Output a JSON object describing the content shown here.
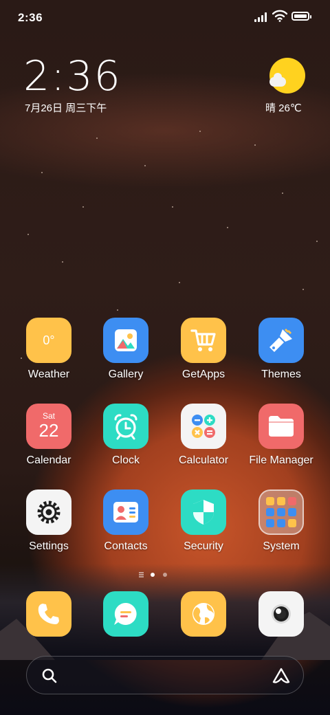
{
  "status_bar": {
    "time": "2:36"
  },
  "clock_widget": {
    "time": "2:36",
    "date": "7月26日 周三下午"
  },
  "weather_widget": {
    "text": "晴 26℃"
  },
  "apps": {
    "weather": {
      "label": "Weather",
      "icon_text": "0°"
    },
    "gallery": {
      "label": "Gallery"
    },
    "getapps": {
      "label": "GetApps"
    },
    "themes": {
      "label": "Themes"
    },
    "calendar": {
      "label": "Calendar",
      "day": "Sat",
      "date": "22"
    },
    "clock": {
      "label": "Clock"
    },
    "calculator": {
      "label": "Calculator"
    },
    "file_manager": {
      "label": "File Manager"
    },
    "settings": {
      "label": "Settings"
    },
    "contacts": {
      "label": "Contacts"
    },
    "security": {
      "label": "Security"
    },
    "system": {
      "label": "System"
    }
  },
  "page_indicator": {
    "current_page": 2,
    "total_pages": 3
  },
  "dock": [
    "phone-icon",
    "messages-icon",
    "browser-icon",
    "camera-icon"
  ],
  "colors": {
    "yellow": "#ffc24a",
    "blue": "#3d8ef2",
    "red": "#f06a6a",
    "teal": "#2ddcc4",
    "white": "#f4f4f4"
  }
}
